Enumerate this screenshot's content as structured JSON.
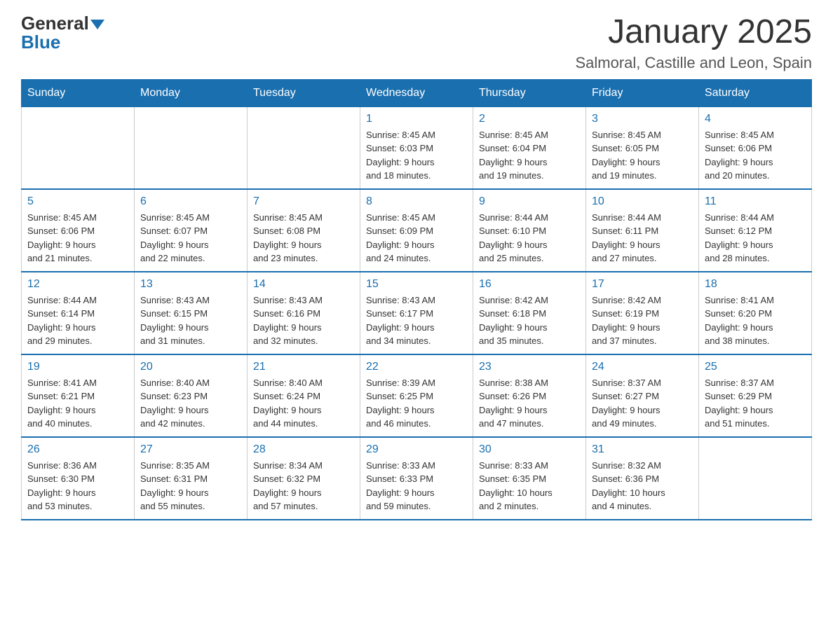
{
  "logo": {
    "general": "General",
    "blue": "Blue"
  },
  "header": {
    "month": "January 2025",
    "location": "Salmoral, Castille and Leon, Spain"
  },
  "weekdays": [
    "Sunday",
    "Monday",
    "Tuesday",
    "Wednesday",
    "Thursday",
    "Friday",
    "Saturday"
  ],
  "weeks": [
    [
      {
        "day": "",
        "info": ""
      },
      {
        "day": "",
        "info": ""
      },
      {
        "day": "",
        "info": ""
      },
      {
        "day": "1",
        "info": "Sunrise: 8:45 AM\nSunset: 6:03 PM\nDaylight: 9 hours\nand 18 minutes."
      },
      {
        "day": "2",
        "info": "Sunrise: 8:45 AM\nSunset: 6:04 PM\nDaylight: 9 hours\nand 19 minutes."
      },
      {
        "day": "3",
        "info": "Sunrise: 8:45 AM\nSunset: 6:05 PM\nDaylight: 9 hours\nand 19 minutes."
      },
      {
        "day": "4",
        "info": "Sunrise: 8:45 AM\nSunset: 6:06 PM\nDaylight: 9 hours\nand 20 minutes."
      }
    ],
    [
      {
        "day": "5",
        "info": "Sunrise: 8:45 AM\nSunset: 6:06 PM\nDaylight: 9 hours\nand 21 minutes."
      },
      {
        "day": "6",
        "info": "Sunrise: 8:45 AM\nSunset: 6:07 PM\nDaylight: 9 hours\nand 22 minutes."
      },
      {
        "day": "7",
        "info": "Sunrise: 8:45 AM\nSunset: 6:08 PM\nDaylight: 9 hours\nand 23 minutes."
      },
      {
        "day": "8",
        "info": "Sunrise: 8:45 AM\nSunset: 6:09 PM\nDaylight: 9 hours\nand 24 minutes."
      },
      {
        "day": "9",
        "info": "Sunrise: 8:44 AM\nSunset: 6:10 PM\nDaylight: 9 hours\nand 25 minutes."
      },
      {
        "day": "10",
        "info": "Sunrise: 8:44 AM\nSunset: 6:11 PM\nDaylight: 9 hours\nand 27 minutes."
      },
      {
        "day": "11",
        "info": "Sunrise: 8:44 AM\nSunset: 6:12 PM\nDaylight: 9 hours\nand 28 minutes."
      }
    ],
    [
      {
        "day": "12",
        "info": "Sunrise: 8:44 AM\nSunset: 6:14 PM\nDaylight: 9 hours\nand 29 minutes."
      },
      {
        "day": "13",
        "info": "Sunrise: 8:43 AM\nSunset: 6:15 PM\nDaylight: 9 hours\nand 31 minutes."
      },
      {
        "day": "14",
        "info": "Sunrise: 8:43 AM\nSunset: 6:16 PM\nDaylight: 9 hours\nand 32 minutes."
      },
      {
        "day": "15",
        "info": "Sunrise: 8:43 AM\nSunset: 6:17 PM\nDaylight: 9 hours\nand 34 minutes."
      },
      {
        "day": "16",
        "info": "Sunrise: 8:42 AM\nSunset: 6:18 PM\nDaylight: 9 hours\nand 35 minutes."
      },
      {
        "day": "17",
        "info": "Sunrise: 8:42 AM\nSunset: 6:19 PM\nDaylight: 9 hours\nand 37 minutes."
      },
      {
        "day": "18",
        "info": "Sunrise: 8:41 AM\nSunset: 6:20 PM\nDaylight: 9 hours\nand 38 minutes."
      }
    ],
    [
      {
        "day": "19",
        "info": "Sunrise: 8:41 AM\nSunset: 6:21 PM\nDaylight: 9 hours\nand 40 minutes."
      },
      {
        "day": "20",
        "info": "Sunrise: 8:40 AM\nSunset: 6:23 PM\nDaylight: 9 hours\nand 42 minutes."
      },
      {
        "day": "21",
        "info": "Sunrise: 8:40 AM\nSunset: 6:24 PM\nDaylight: 9 hours\nand 44 minutes."
      },
      {
        "day": "22",
        "info": "Sunrise: 8:39 AM\nSunset: 6:25 PM\nDaylight: 9 hours\nand 46 minutes."
      },
      {
        "day": "23",
        "info": "Sunrise: 8:38 AM\nSunset: 6:26 PM\nDaylight: 9 hours\nand 47 minutes."
      },
      {
        "day": "24",
        "info": "Sunrise: 8:37 AM\nSunset: 6:27 PM\nDaylight: 9 hours\nand 49 minutes."
      },
      {
        "day": "25",
        "info": "Sunrise: 8:37 AM\nSunset: 6:29 PM\nDaylight: 9 hours\nand 51 minutes."
      }
    ],
    [
      {
        "day": "26",
        "info": "Sunrise: 8:36 AM\nSunset: 6:30 PM\nDaylight: 9 hours\nand 53 minutes."
      },
      {
        "day": "27",
        "info": "Sunrise: 8:35 AM\nSunset: 6:31 PM\nDaylight: 9 hours\nand 55 minutes."
      },
      {
        "day": "28",
        "info": "Sunrise: 8:34 AM\nSunset: 6:32 PM\nDaylight: 9 hours\nand 57 minutes."
      },
      {
        "day": "29",
        "info": "Sunrise: 8:33 AM\nSunset: 6:33 PM\nDaylight: 9 hours\nand 59 minutes."
      },
      {
        "day": "30",
        "info": "Sunrise: 8:33 AM\nSunset: 6:35 PM\nDaylight: 10 hours\nand 2 minutes."
      },
      {
        "day": "31",
        "info": "Sunrise: 8:32 AM\nSunset: 6:36 PM\nDaylight: 10 hours\nand 4 minutes."
      },
      {
        "day": "",
        "info": ""
      }
    ]
  ]
}
